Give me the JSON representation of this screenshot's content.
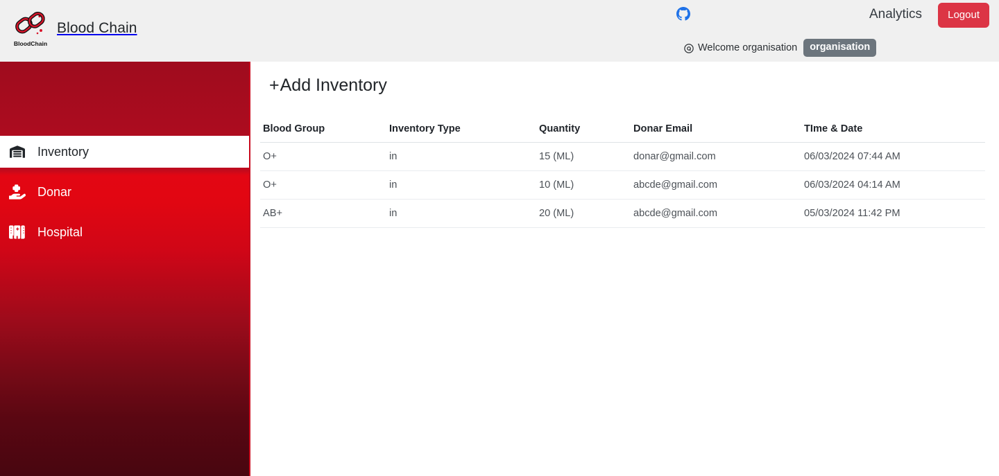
{
  "header": {
    "brand_title": "Blood Chain",
    "logo_caption": "BloodChain",
    "github_icon": "github-icon",
    "analytics_label": "Analytics",
    "logout_label": "Logout",
    "welcome_text": "Welcome organisation",
    "org_badge": "organisation",
    "user_icon": "user-circle-icon",
    "colors": {
      "header_bg": "#f0f0f0",
      "logout_bg": "#dc3545",
      "badge_bg": "#6c757d",
      "github_blue": "#1f72e8"
    }
  },
  "sidebar": {
    "items": [
      {
        "label": "Inventory",
        "icon": "warehouse-icon",
        "active": true
      },
      {
        "label": "Donar",
        "icon": "hand-holding-medical-icon",
        "active": false
      },
      {
        "label": "Hospital",
        "icon": "hospital-icon",
        "active": false
      }
    ],
    "colors": {
      "gradient_top": "#9f0c1e",
      "gradient_mid": "#e30613",
      "gradient_bottom": "#480610",
      "active_bg": "#ffffff"
    }
  },
  "main": {
    "page_title": "Add Inventory",
    "page_title_prefix": "+",
    "table": {
      "columns": [
        "Blood Group",
        "Inventory Type",
        "Quantity",
        "Donar Email",
        "TIme & Date"
      ],
      "rows": [
        {
          "blood_group": "O+",
          "inventory_type": "in",
          "quantity": "15 (ML)",
          "donar_email": "donar@gmail.com",
          "time_date": "06/03/2024 07:44 AM"
        },
        {
          "blood_group": "O+",
          "inventory_type": "in",
          "quantity": "10 (ML)",
          "donar_email": "abcde@gmail.com",
          "time_date": "06/03/2024 04:14 AM"
        },
        {
          "blood_group": "AB+",
          "inventory_type": "in",
          "quantity": "20 (ML)",
          "donar_email": "abcde@gmail.com",
          "time_date": "05/03/2024 11:42 PM"
        }
      ]
    }
  }
}
